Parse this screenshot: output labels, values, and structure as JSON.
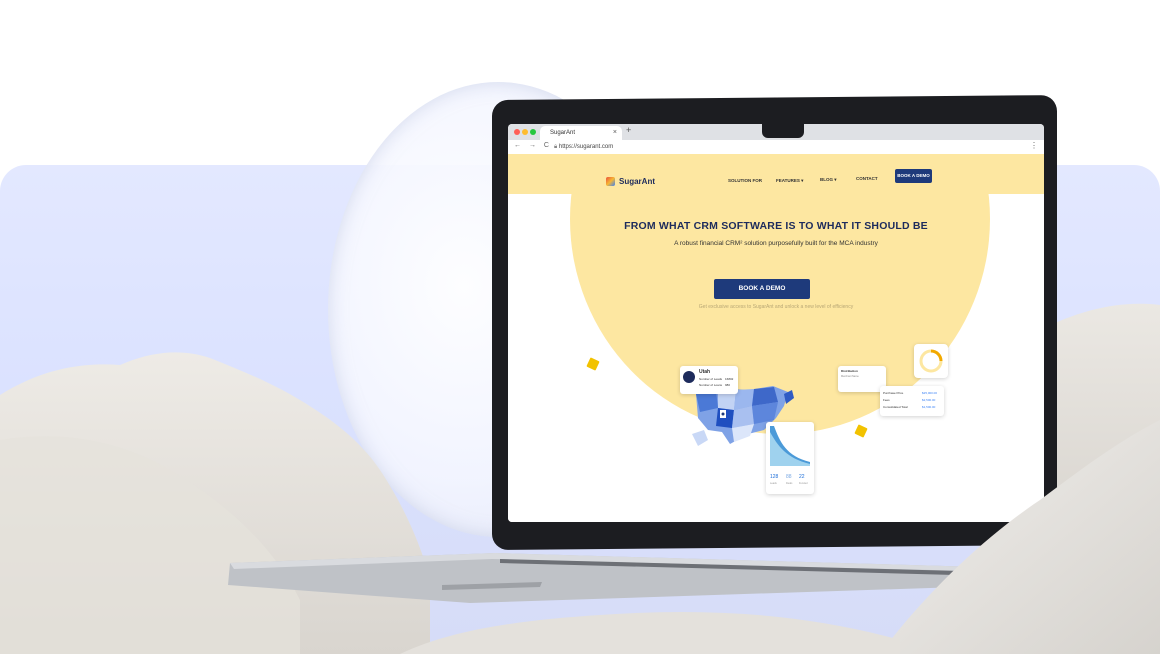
{
  "browser": {
    "tab_title": "SugarAnt",
    "tab_close": "×",
    "new_tab": "+",
    "nav_icons": "← → C",
    "url": "https://sugarant.com",
    "menu": "⋮"
  },
  "site": {
    "logo_text": "SugarAnt",
    "nav": {
      "solution": "SOLUTION FOR",
      "features": "FEATURES ▾",
      "blog": "BLOG ▾",
      "contact": "CONTACT",
      "cta": "BOOK A DEMO"
    },
    "headline": "FROM WHAT CRM SOFTWARE IS TO WHAT IT SHOULD BE",
    "subheadline": "A robust financial CRM² solution purposefully built for the MCA industry",
    "cta": "BOOK A DEMO",
    "note": "Get exclusive access to SugarAnt and unlock a new level of efficiency",
    "map_card": {
      "state": "Utah",
      "row1_label": "Number of Leads",
      "row1_value": "16802",
      "row2_label": "Number of Loans",
      "row2_value": "980"
    },
    "chart_card": {
      "stat1": "128",
      "stat2": "88",
      "stat3": "22",
      "stat1_label": "Leads",
      "stat2_label": "Deals",
      "stat3_label": "Funded"
    },
    "deal_card": {
      "title": "Distribution",
      "line1": "Merchant Name",
      "row1_label": "Purchase Price",
      "row1_value": "$25,000.00",
      "row2_label": "Fees",
      "row2_value": "$2,500.00",
      "row3_label": "Consolidated Total",
      "row3_value": "$1,500.00"
    }
  },
  "colors": {
    "brand_navy": "#1e3a7b",
    "hero_yellow": "#fde7a1",
    "backdrop_lavender": "#dbe2ff",
    "accent_gold": "#f2c200"
  }
}
